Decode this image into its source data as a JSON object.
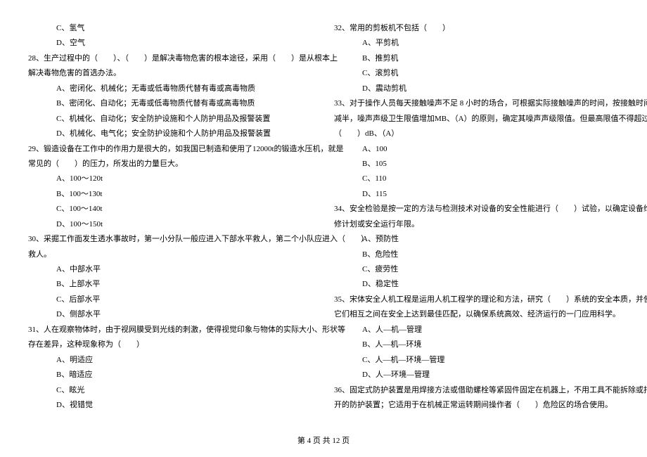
{
  "left": {
    "q27_optC": "C、氢气",
    "q27_optD": "D、空气",
    "q28_stem1": "28、生产过程中的（　　）、（　　）是解决毒物危害的根本途径，采用（　　）是从根本上",
    "q28_stem2": "解决毒物危害的首选办法。",
    "q28_optA": "A、密闭化、机械化；无毒或低毒物质代替有毒或高毒物质",
    "q28_optB": "B、密闭化、自动化；无毒或低毒物质代替有毒或高毒物质",
    "q28_optC": "C、机械化、自动化；安全防护设施和个人防护用品及报警装置",
    "q28_optD": "D、机械化、电气化；安全防护设施和个人防护用品及报警装置",
    "q29_stem1": "29、锻造设备在工作中的作用力是很大的，如我国已制造和使用了12000t的锻造水压机，就是",
    "q29_stem2": "常见的（　　）的压力，所发出的力量巨大。",
    "q29_optA": "A、100～120t",
    "q29_optB": "B、100～130t",
    "q29_optC": "C、100～140t",
    "q29_optD": "D、100～150t",
    "q30_stem1": "30、采掘工作面发生透水事故时，第一小分队一般应进入下部水平救人，第二个小队应进入（　　）",
    "q30_stem2": "救人。",
    "q30_optA": "A、中部水平",
    "q30_optB": "B、上部水平",
    "q30_optC": "C、后部水平",
    "q30_optD": "D、侧部水平",
    "q31_stem1": "31、人在观察物体时，由于视网膜受到光线的刺激，使得视觉印象与物体的实际大小、形状等",
    "q31_stem2": "存在差异，这种现象称为（　　）",
    "q31_optA": "A、明适应",
    "q31_optB": "B、暗适应",
    "q31_optC": "C、眩光",
    "q31_optD": "D、视错觉"
  },
  "right": {
    "q32_stem": "32、常用的剪板机不包括（　　）",
    "q32_optA": "A、平剪机",
    "q32_optB": "B、推剪机",
    "q32_optC": "C、滚剪机",
    "q32_optD": "D、震动剪机",
    "q33_stem1": "33、对于操作人员每天接触噪声不足 8 小时的场合，可根据实际接触噪声的时间，按接触时间",
    "q33_stem2": "减半，噪声声级卫生限值增加MB、（A）的原则，确定其噪声声级限值。但最高限值不得超过",
    "q33_stem3": "（　　）dB、（A）",
    "q33_optA": "A、100",
    "q33_optB": "B、105",
    "q33_optC": "C、110",
    "q33_optD": "D、115",
    "q34_stem1": "34、安全检验是按一定的方法与检测技术对设备的安全性能进行（　　）试验，以确定设备维",
    "q34_stem2": "修计划或安全运行年限。",
    "q34_optA": "A、预防性",
    "q34_optB": "B、危险性",
    "q34_optC": "C、疲劳性",
    "q34_optD": "D、稳定性",
    "q35_stem1": "35、宋体安全人机工程是运用人机工程学的理论和方法，研究（　　）系统的安全本质，并使",
    "q35_stem2": "它们相互之间在安全上达到最佳匹配，以确保系统高效、经济运行的一门应用科学。",
    "q35_optA": "A、人—机—管理",
    "q35_optB": "B、人—机—环境",
    "q35_optC": "C、人—机—环境—管理",
    "q35_optD": "D、人—环境—管理",
    "q36_stem1": "36、固定式防护装置是用焊接方法或借助螺栓等紧固件固定在机器上，不用工具不能拆除或打",
    "q36_stem2": "开的防护装置；它适用于在机械正常运转期间操作者（　　）危险区的场合使用。"
  },
  "footer": "第 4 页 共 12 页"
}
